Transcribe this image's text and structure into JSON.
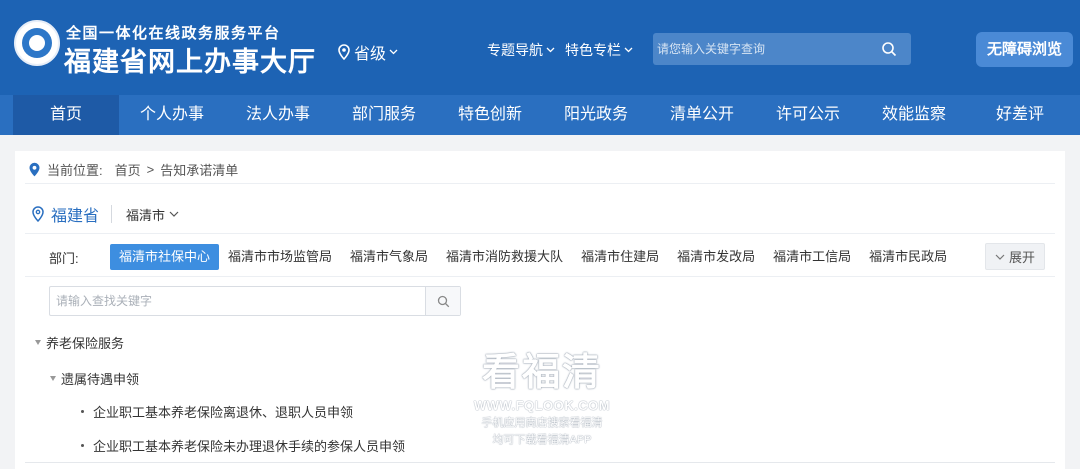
{
  "header": {
    "logo_line1": "全国一体化在线政务服务平台",
    "logo_line2": "福建省网上办事大厅",
    "region": "省级",
    "topnav": [
      "专题导航",
      "特色专栏"
    ],
    "search_placeholder": "请您输入关键字查询",
    "accessibility_button": "无障碍浏览"
  },
  "mainnav": [
    "首页",
    "个人办事",
    "法人办事",
    "部门服务",
    "特色创新",
    "阳光政务",
    "清单公开",
    "许可公示",
    "效能监察",
    "好差评"
  ],
  "breadcrumb": {
    "label": "当前位置:",
    "home": "首页",
    "separator": ">",
    "current": "告知承诺清单"
  },
  "location": {
    "province": "福建省",
    "city": "福清市"
  },
  "departments": {
    "label": "部门:",
    "items": [
      "福清市社保中心",
      "福清市市场监管局",
      "福清市气象局",
      "福清市消防救援大队",
      "福清市住建局",
      "福清市发改局",
      "福清市工信局",
      "福清市民政局"
    ],
    "expand_label": "展开"
  },
  "filter": {
    "placeholder": "请输入查找关键字"
  },
  "tree": {
    "level1": "养老保险服务",
    "level2": "遗属待遇申领",
    "items": [
      "企业职工基本养老保险离退休、退职人员申领",
      "企业职工基本养老保险未办理退休手续的参保人员申领"
    ]
  },
  "watermark": {
    "title": "看福清",
    "url": "WWW.FQLOOK.COM",
    "line1": "手机应用商店搜索看福清",
    "line2": "均可下载看福清APP"
  },
  "colors": {
    "header_bg": "#1d63b4",
    "nav_bg": "#2a6fc0",
    "active_dept": "#3d8ee0"
  }
}
